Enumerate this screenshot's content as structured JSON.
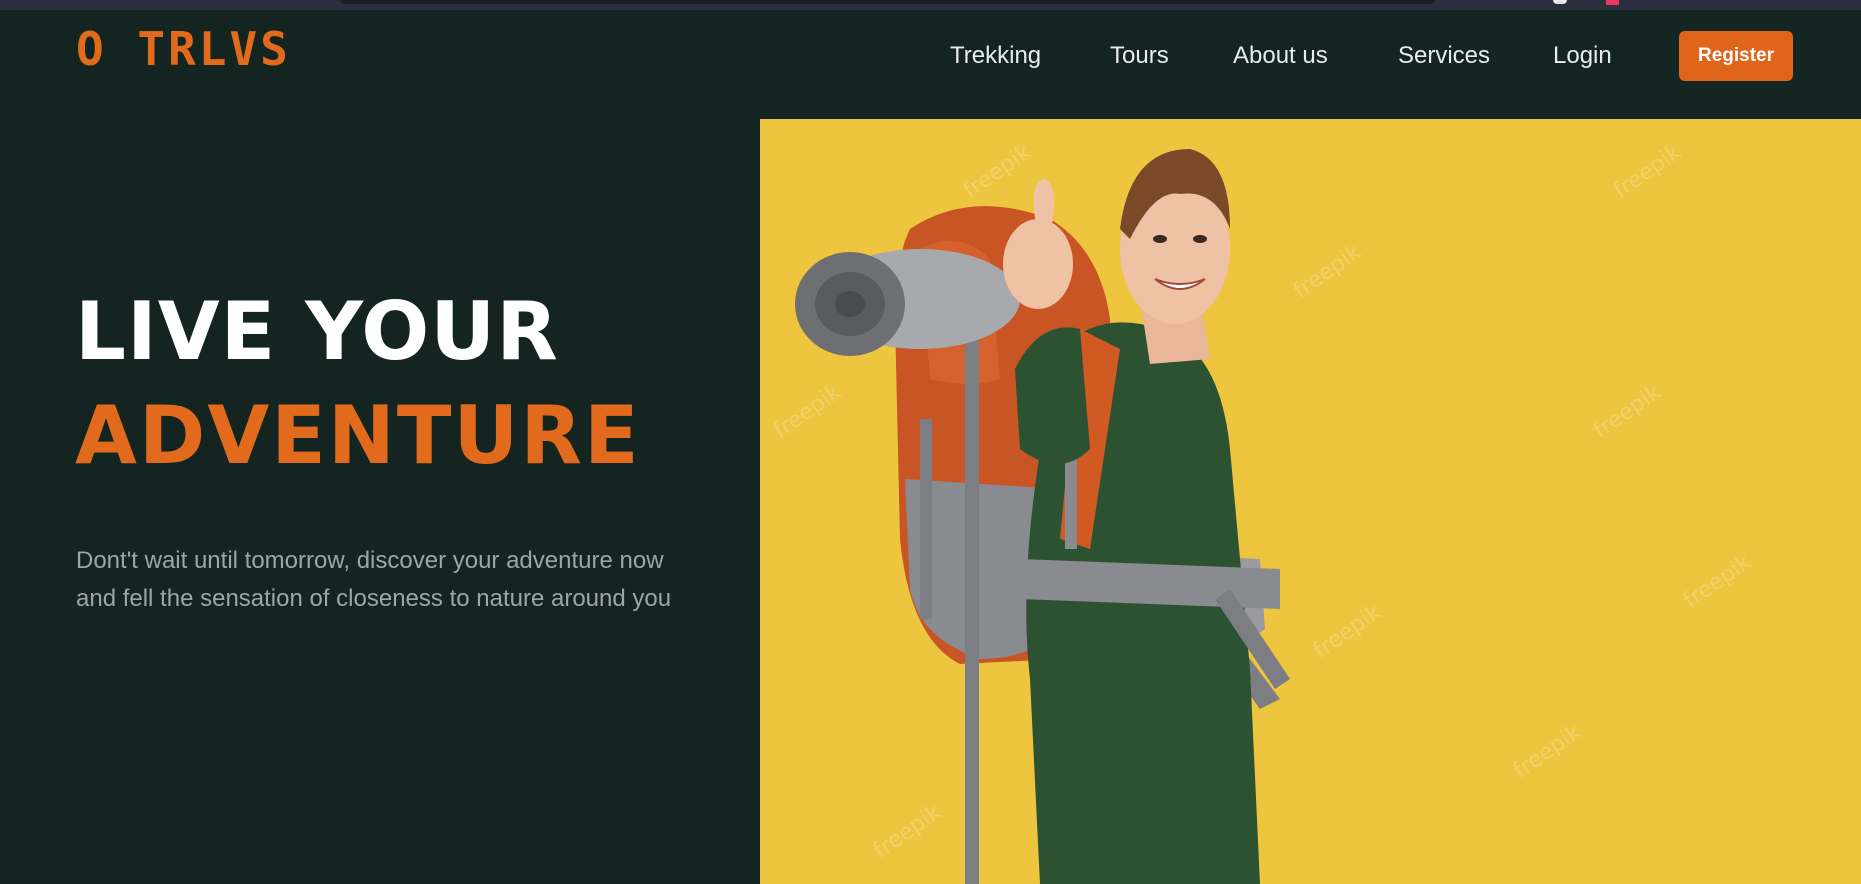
{
  "brand": {
    "logo_text": "O TRLVS",
    "accent_color": "#e26a1c",
    "background_color": "#132421"
  },
  "nav": {
    "items": [
      {
        "label": "Trekking"
      },
      {
        "label": "Tours"
      },
      {
        "label": "About us"
      },
      {
        "label": "Services"
      },
      {
        "label": "Login"
      }
    ],
    "register_label": "Register"
  },
  "hero": {
    "title_line1": "LIVE YOUR",
    "title_line2": "ADVENTURE",
    "subtitle": "Dont't wait until tomorrow, discover your adventure now and fell the sensation of closeness to nature around you",
    "image_background_color": "#eec53f",
    "watermark_text": "freepik"
  }
}
